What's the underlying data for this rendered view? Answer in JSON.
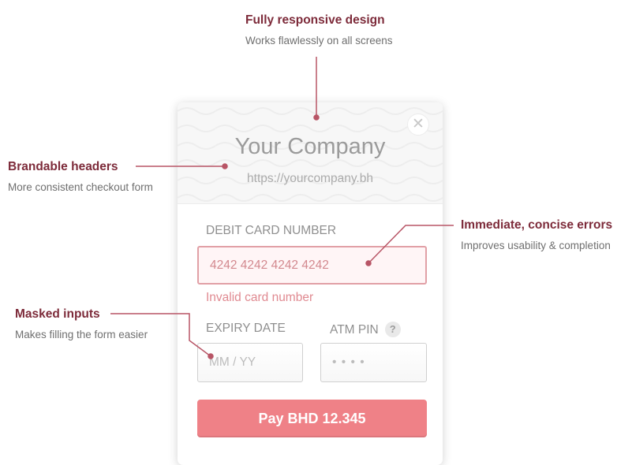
{
  "callouts": {
    "responsive": {
      "title": "Fully responsive design",
      "subtitle": "Works flawlessly on all screens"
    },
    "headers": {
      "title": "Brandable headers",
      "subtitle": "More consistent checkout form"
    },
    "errors": {
      "title": "Immediate, concise errors",
      "subtitle": "Improves usability & completion"
    },
    "masked": {
      "title": "Masked inputs",
      "subtitle": "Makes filling the form easier"
    }
  },
  "checkout": {
    "company_name": "Your Company",
    "company_url": "https://yourcompany.bh",
    "close_icon": "close-icon",
    "card_number": {
      "label": "DEBIT CARD NUMBER",
      "value": "4242 4242 4242 4242",
      "error": "Invalid card number"
    },
    "expiry": {
      "label": "EXPIRY DATE",
      "placeholder": "MM / YY"
    },
    "pin": {
      "label": "ATM PIN",
      "placeholder": "• • • •",
      "help": "?"
    },
    "pay_button": "Pay BHD 12.345"
  },
  "colors": {
    "accent": "#ef8187",
    "callout_title": "#7d2b3a",
    "connector": "#b85566",
    "error": "#e08a91"
  }
}
